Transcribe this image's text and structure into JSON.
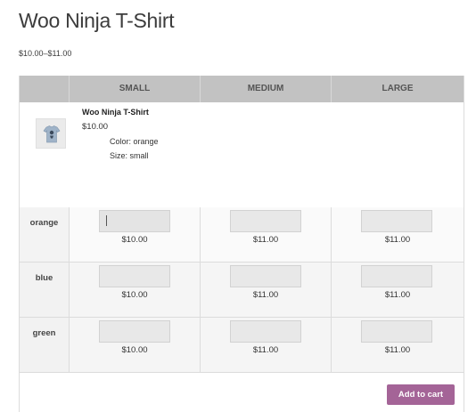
{
  "product": {
    "title": "Woo Ninja T-Shirt",
    "price_range": "$10.00–$11.00"
  },
  "grid": {
    "header": {
      "corner": "",
      "columns": [
        "SMALL",
        "MEDIUM",
        "LARGE"
      ]
    },
    "selected": {
      "name": "Woo Ninja T-Shirt",
      "price": "$10.00",
      "color": "Color: orange",
      "size": "Size: small"
    },
    "rows": [
      {
        "label": "orange",
        "prices": [
          "$10.00",
          "$11.00",
          "$11.00"
        ],
        "quantities": [
          "",
          "",
          ""
        ]
      },
      {
        "label": "blue",
        "prices": [
          "$10.00",
          "$11.00",
          "$11.00"
        ],
        "quantities": [
          "",
          "",
          ""
        ]
      },
      {
        "label": "green",
        "prices": [
          "$10.00",
          "$11.00",
          "$11.00"
        ],
        "quantities": [
          "",
          "",
          ""
        ]
      }
    ]
  },
  "actions": {
    "add_to_cart_label": "Add to cart"
  },
  "colors": {
    "accent": "#a46497",
    "header_bg": "#c2c2c2"
  },
  "icons": {
    "thumbnail": "tshirt-thumbnail-icon"
  }
}
